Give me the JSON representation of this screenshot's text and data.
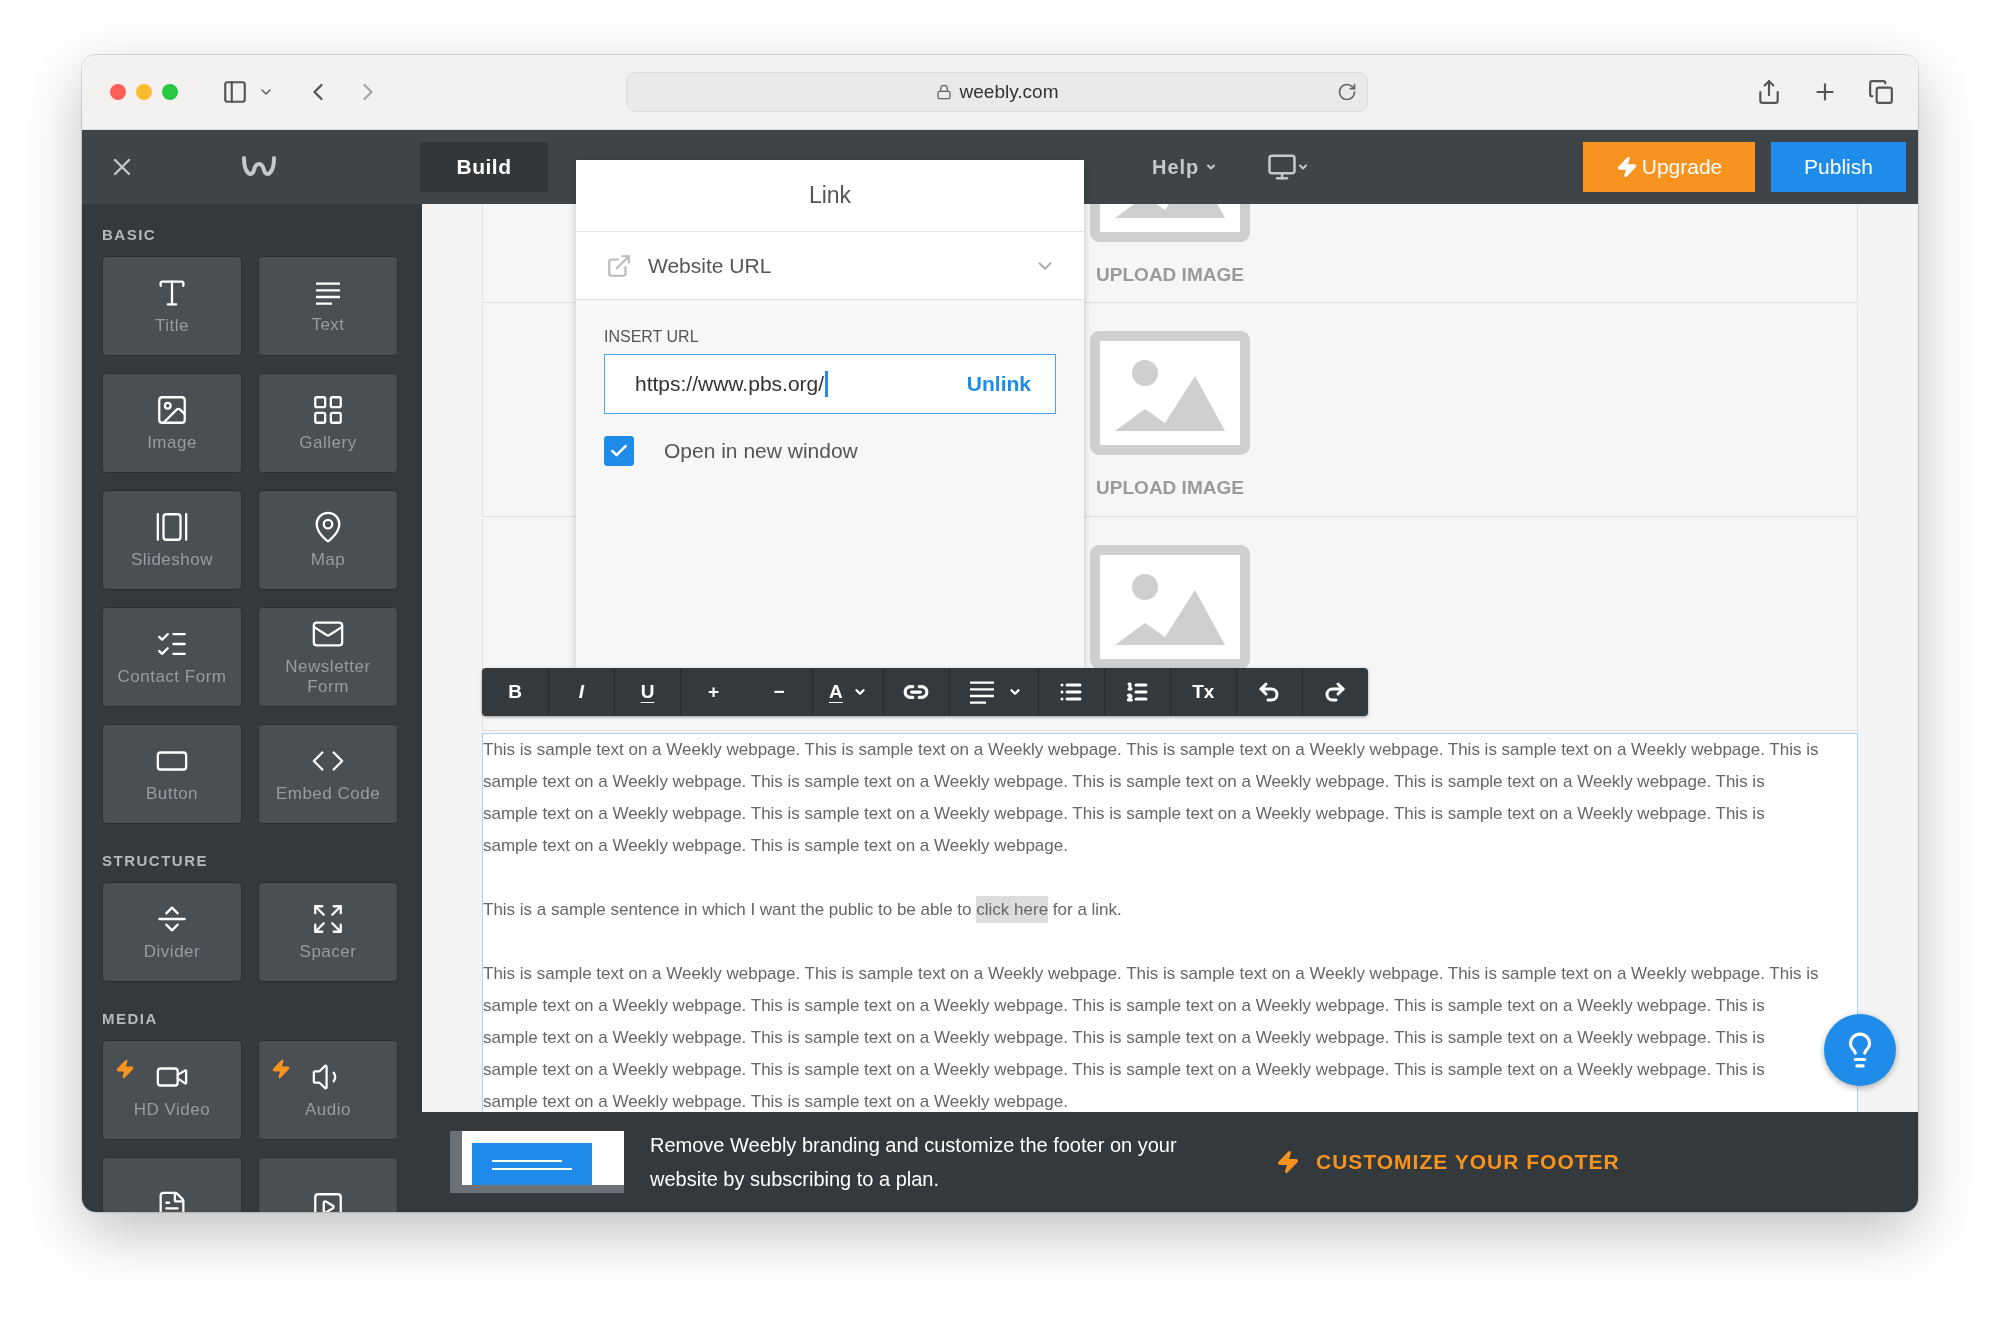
{
  "browser": {
    "url": "weebly.com"
  },
  "header": {
    "tabs": [
      {
        "label": "Build",
        "selected": true
      }
    ],
    "help": "Help",
    "upgrade": "Upgrade",
    "publish": "Publish"
  },
  "sidebar": {
    "sections": [
      {
        "title": "BASIC",
        "items": [
          {
            "label": "Title",
            "pro": false
          },
          {
            "label": "Text",
            "pro": false
          },
          {
            "label": "Image",
            "pro": false
          },
          {
            "label": "Gallery",
            "pro": false
          },
          {
            "label": "Slideshow",
            "pro": false
          },
          {
            "label": "Map",
            "pro": false
          },
          {
            "label": "Contact Form",
            "pro": false
          },
          {
            "label": "Newsletter Form",
            "pro": false
          },
          {
            "label": "Button",
            "pro": false
          },
          {
            "label": "Embed Code",
            "pro": false
          }
        ]
      },
      {
        "title": "STRUCTURE",
        "items": [
          {
            "label": "Divider",
            "pro": false
          },
          {
            "label": "Spacer",
            "pro": false
          }
        ]
      },
      {
        "title": "MEDIA",
        "items": [
          {
            "label": "HD Video",
            "pro": true
          },
          {
            "label": "Audio",
            "pro": true
          },
          {
            "pro": false
          },
          {
            "pro": false
          }
        ]
      }
    ]
  },
  "canvas": {
    "image_rows": [
      {
        "label": "UPLOAD IMAGE"
      },
      {
        "label": "UPLOAD IMAGE"
      },
      {}
    ],
    "paragraphs": [
      {
        "lines": [
          "This is sample text on a Weekly webpage. This is sample text on a Weekly webpage. This is sample text on a Weekly webpage. This is sample text on a Weekly webpage. This is",
          "sample text on a Weekly webpage. This is sample text on a Weekly webpage. This is sample text on a Weekly webpage. This is sample text on a Weekly webpage. This is",
          "sample text on a Weekly webpage. This is sample text on a Weekly webpage. This is sample text on a Weekly webpage. This is sample text on a Weekly webpage. This is",
          "sample text on a Weekly webpage. This is sample text on a Weekly webpage."
        ]
      },
      {
        "text": "This is a sample sentence in which I want the public to be able to ",
        "link": "click here",
        "after": " for a link."
      },
      {
        "lines": [
          "This is sample text on a Weekly webpage. This is sample text on a Weekly webpage. This is sample text on a Weekly webpage. This is sample text on a Weekly webpage. This is",
          "sample text on a Weekly webpage. This is sample text on a Weekly webpage. This is sample text on a Weekly webpage. This is sample text on a Weekly webpage. This is",
          "sample text on a Weekly webpage. This is sample text on a Weekly webpage. This is sample text on a Weekly webpage. This is sample text on a Weekly webpage. This is",
          "sample text on a Weekly webpage. This is sample text on a Weekly webpage. This is sample text on a Weekly webpage. This is sample text on a Weekly webpage. This is",
          "sample text on a Weekly webpage. This is sample text on a Weekly webpage."
        ]
      }
    ]
  },
  "link_dialog": {
    "title": "Link",
    "type": "Website URL",
    "field_label": "INSERT URL",
    "url": "https://www.pbs.org/",
    "unlink": "Unlink",
    "new_window": {
      "label": "Open in new window",
      "checked": true
    }
  },
  "toolbar": [
    {
      "kind": "bold",
      "label": "B"
    },
    {
      "kind": "italic",
      "label": "I"
    },
    {
      "kind": "underline",
      "label": "U"
    },
    {
      "kind": "text",
      "label": "+"
    },
    {
      "kind": "text",
      "label": "−"
    },
    {
      "kind": "color",
      "label": "A"
    },
    {
      "kind": "link"
    },
    {
      "kind": "align"
    },
    {
      "kind": "bullets"
    },
    {
      "kind": "numbered"
    },
    {
      "kind": "text",
      "label": "Tx"
    },
    {
      "kind": "undo"
    },
    {
      "kind": "redo"
    }
  ],
  "footer": {
    "message": "Remove Weebly branding and customize the footer on your website by subscribing to a plan.",
    "action": "CUSTOMIZE YOUR FOOTER"
  }
}
